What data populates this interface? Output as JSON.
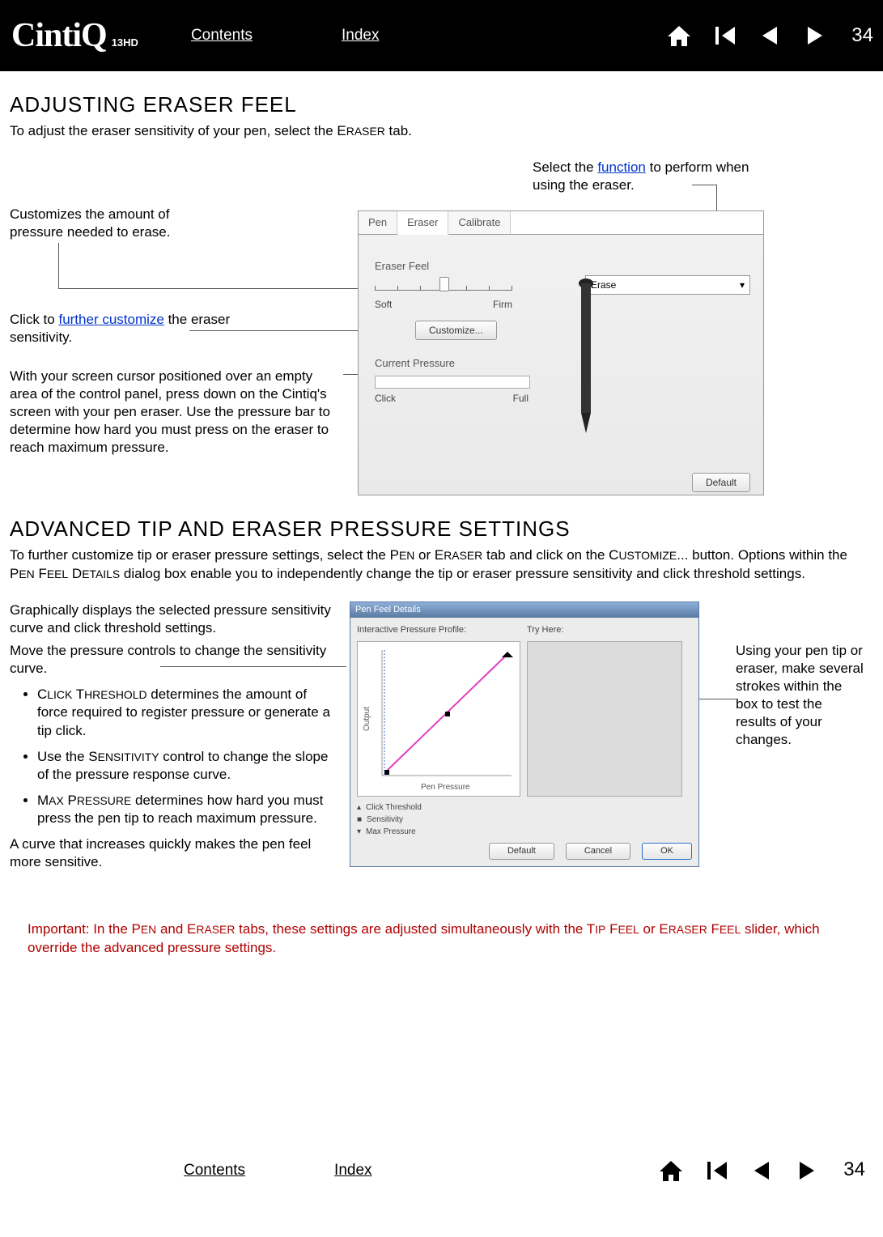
{
  "brand": {
    "main": "CintiQ",
    "sub": "13HD"
  },
  "nav": {
    "contents": "Contents",
    "index": "Index",
    "page": "34"
  },
  "section1": {
    "heading": "ADJUSTING ERASER FEEL",
    "intro_a": "To adjust the eraser sensitivity of your pen, select the E",
    "intro_b": "RASER",
    "intro_c": " tab."
  },
  "callouts1": {
    "topright_a": "Select the ",
    "topright_link": "function",
    "topright_b": " to perform when using the eraser.",
    "pressure": "Customizes the amount of pressure needed to erase.",
    "customize_a": "Click to ",
    "customize_link": "further customize",
    "customize_b": " the eraser sensitivity.",
    "cursor": "With your screen cursor positioned over an empty area of the control panel, press down on the Cintiq's screen with your pen eraser. Use the pressure bar to determine how hard you must press on the eraser to reach maximum pressure."
  },
  "panel1": {
    "tabs": {
      "pen": "Pen",
      "eraser": "Eraser",
      "calibrate": "Calibrate"
    },
    "eraser_feel": "Eraser Feel",
    "soft": "Soft",
    "firm": "Firm",
    "customize_btn": "Customize...",
    "current_pressure": "Current Pressure",
    "click": "Click",
    "full": "Full",
    "erase_dropdown": "Erase",
    "default_btn": "Default"
  },
  "section2": {
    "heading": "ADVANCED TIP AND ERASER PRESSURE SETTINGS",
    "intro_a": "To further customize tip or eraser pressure settings, select the P",
    "intro_b": "EN",
    "intro_c": " or E",
    "intro_d": "RASER",
    "intro_e": " tab and click on the C",
    "intro_f": "USTOMIZE",
    "intro_g": "... button. Options within the P",
    "intro_h": "EN",
    "intro_i": " F",
    "intro_j": "EEL",
    "intro_k": " D",
    "intro_l": "ETAILS",
    "intro_m": " dialog box enable you to independently change the tip or eraser pressure sensitivity and click threshold settings."
  },
  "notes2": {
    "p1": "Graphically displays the selected pressure sensitivity curve and click threshold settings.",
    "p2": "Move the pressure controls to change the sensitivity curve.",
    "li1_a": "C",
    "li1_b": "LICK",
    "li1_c": " T",
    "li1_d": "HRESHOLD",
    "li1_e": " determines the amount of force required to register pressure or generate a tip click.",
    "li2_a": "Use the S",
    "li2_b": "ENSITIVITY",
    "li2_c": " control to change the slope of the pressure response curve.",
    "li3_a": "M",
    "li3_b": "AX",
    "li3_c": " P",
    "li3_d": "RESSURE",
    "li3_e": " determines how hard you must press the pen tip to reach maximum pressure.",
    "p3": "A curve that increases quickly makes the pen feel more sensitive.",
    "right": "Using your pen tip or eraser, make several strokes within the box to test the results of your changes."
  },
  "panel2": {
    "title": "Pen Feel Details",
    "interactive": "Interactive Pressure Profile:",
    "tryhere": "Try Here:",
    "output": "Output",
    "penpressure": "Pen  Pressure",
    "legend_click": "Click Threshold",
    "legend_sens": "Sensitivity",
    "legend_max": "Max Pressure",
    "default_btn": "Default",
    "cancel_btn": "Cancel",
    "ok_btn": "OK"
  },
  "important": {
    "a": "Important: In the P",
    "b": "EN",
    "c": " and E",
    "d": "RASER",
    "e": " tabs, these settings are adjusted simultaneously with the T",
    "f": "IP",
    "g": " F",
    "h": "EEL",
    "i": " or E",
    "j": "RASER",
    "k": " F",
    "l": "EEL",
    "m": " slider, which override the advanced pressure settings."
  }
}
